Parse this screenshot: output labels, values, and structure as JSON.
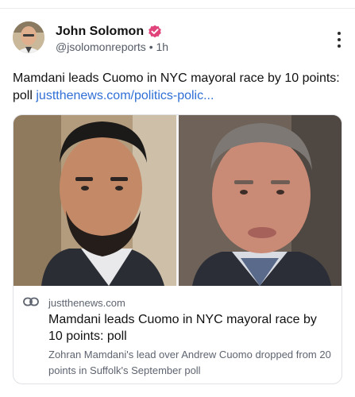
{
  "post": {
    "author_name": "John Solomon",
    "handle": "@jsolomonreports",
    "separator": "•",
    "time": "1h",
    "text": "Mamdani leads Cuomo in NYC mayoral race by 10 points: poll ",
    "link_text": "justthenews.com/politics-polic..."
  },
  "card": {
    "domain": "justthenews.com",
    "title": "Mamdani leads Cuomo in NYC mayoral race by 10 points: poll",
    "description": "Zohran Mamdani's lead over Andrew Cuomo dropped from 20 points in Suffolk's September poll"
  },
  "icons": {
    "verified": "verified-badge-icon",
    "more": "more-vertical-icon",
    "link": "link-icon"
  },
  "colors": {
    "link": "#2f6fd6",
    "verified": "#e0447a",
    "secondary_text": "#5e6470"
  }
}
